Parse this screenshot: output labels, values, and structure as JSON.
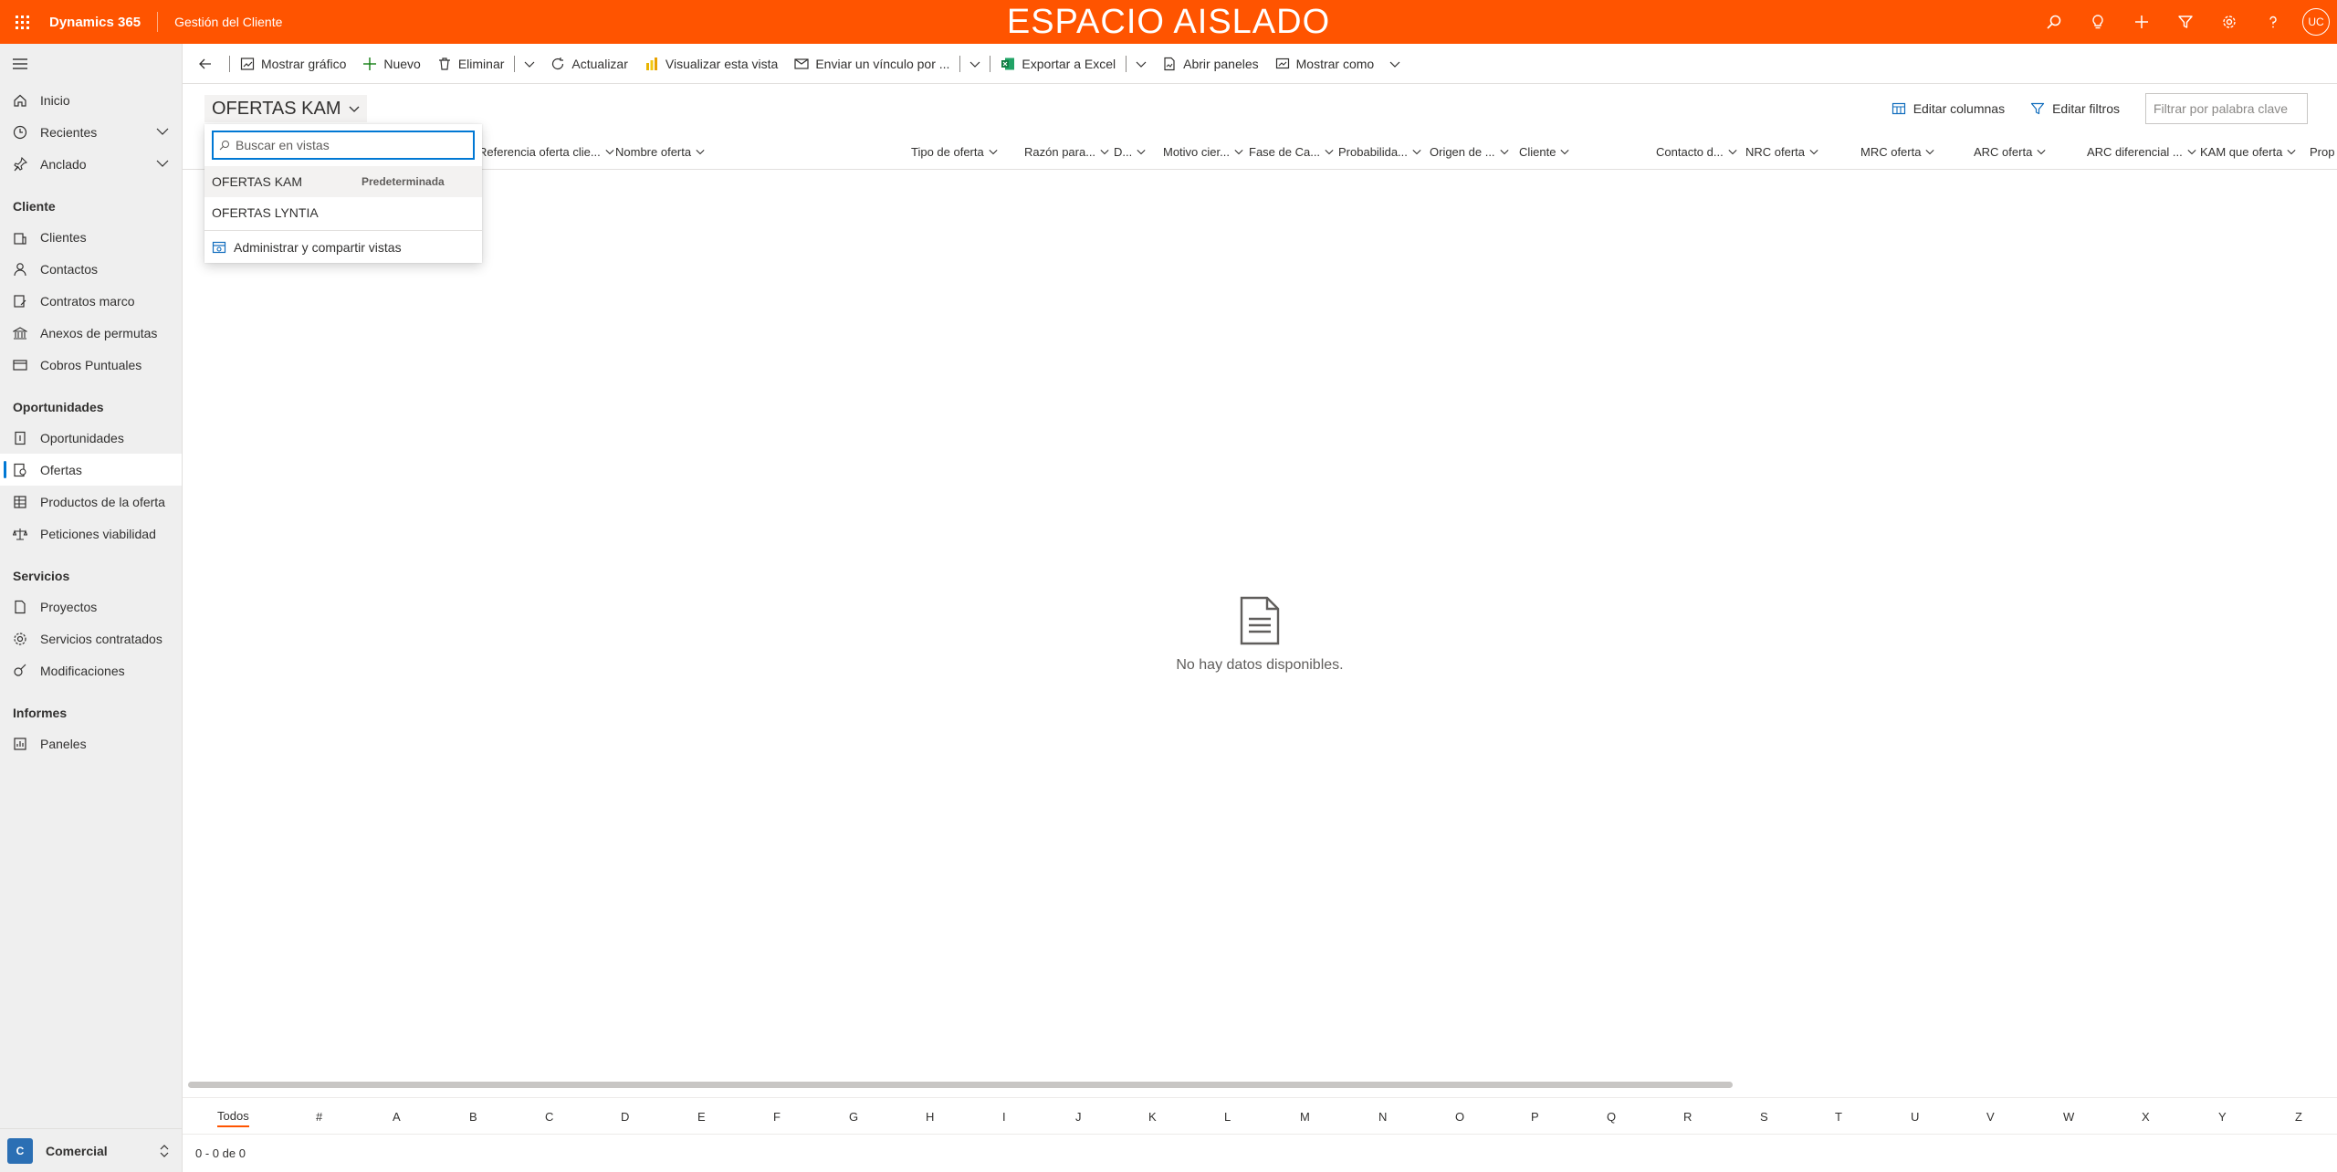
{
  "topbar": {
    "app_name": "Dynamics 365",
    "module_name": "Gestión del Cliente",
    "environment_banner": "ESPACIO AISLADO",
    "user_initials": "UC",
    "bg_color": "#ff5400",
    "icons": [
      "search-icon",
      "lightbulb-icon",
      "plus-icon",
      "filter-icon",
      "gear-icon",
      "help-icon"
    ]
  },
  "sidebar": {
    "top_items": [
      {
        "label": "Inicio",
        "icon": "home-icon"
      },
      {
        "label": "Recientes",
        "icon": "clock-icon"
      },
      {
        "label": "Anclado",
        "icon": "pin-icon"
      }
    ],
    "sections": [
      {
        "title": "Cliente",
        "items": [
          {
            "label": "Clientes",
            "icon": "building-icon"
          },
          {
            "label": "Contactos",
            "icon": "person-icon"
          },
          {
            "label": "Contratos marco",
            "icon": "contract-icon"
          },
          {
            "label": "Anexos de permutas",
            "icon": "bank-icon"
          },
          {
            "label": "Cobros Puntuales",
            "icon": "card-icon"
          }
        ]
      },
      {
        "title": "Oportunidades",
        "items": [
          {
            "label": "Oportunidades",
            "icon": "opportunity-icon"
          },
          {
            "label": "Ofertas",
            "icon": "quote-icon",
            "selected": true
          },
          {
            "label": "Productos de la oferta",
            "icon": "table-icon"
          },
          {
            "label": "Peticiones viabilidad",
            "icon": "scale-icon"
          }
        ]
      },
      {
        "title": "Servicios",
        "items": [
          {
            "label": "Proyectos",
            "icon": "document-icon"
          },
          {
            "label": "Servicios contratados",
            "icon": "services-icon"
          },
          {
            "label": "Modificaciones",
            "icon": "modify-icon"
          }
        ]
      },
      {
        "title": "Informes",
        "items": [
          {
            "label": "Paneles",
            "icon": "dashboard-icon"
          }
        ]
      }
    ],
    "area": {
      "badge": "C",
      "label": "Comercial",
      "badge_color": "#2b6fb4"
    }
  },
  "commandbar": {
    "items": [
      {
        "label": "Mostrar gráfico",
        "icon": "chart-icon"
      },
      {
        "label": "Nuevo",
        "icon": "plus-icon"
      },
      {
        "label": "Eliminar",
        "icon": "trash-icon"
      },
      {
        "label": "Actualizar",
        "icon": "refresh-icon"
      },
      {
        "label": "Visualizar esta vista",
        "icon": "powerbi-icon"
      },
      {
        "label": "Enviar un vínculo por ...",
        "icon": "mail-link-icon"
      },
      {
        "label": "Exportar a Excel",
        "icon": "excel-icon"
      },
      {
        "label": "Abrir paneles",
        "icon": "panel-icon"
      },
      {
        "label": "Mostrar como",
        "icon": "view-icon"
      }
    ]
  },
  "view": {
    "title": "OFERTAS KAM",
    "edit_columns": "Editar columnas",
    "edit_filters": "Editar filtros",
    "keyword_placeholder": "Filtrar por palabra clave"
  },
  "columns": [
    "Referencia oferta clie...",
    "Nombre oferta",
    "Tipo de oferta",
    "Razón para...",
    "D...",
    "Motivo cier...",
    "Fase de Ca...",
    "Probabilida...",
    "Origen de ...",
    "Cliente",
    "Contacto d...",
    "NRC oferta",
    "MRC oferta",
    "ARC oferta",
    "ARC diferencial ...",
    "KAM que oferta",
    "Prop"
  ],
  "empty_state": "No hay datos disponibles.",
  "jumpbar": [
    "Todos",
    "#",
    "A",
    "B",
    "C",
    "D",
    "E",
    "F",
    "G",
    "H",
    "I",
    "J",
    "K",
    "L",
    "M",
    "N",
    "O",
    "P",
    "Q",
    "R",
    "S",
    "T",
    "U",
    "V",
    "W",
    "X",
    "Y",
    "Z"
  ],
  "footer_count": "0 - 0 de 0",
  "view_selector": {
    "search_placeholder": "Buscar en vistas",
    "views": [
      {
        "name": "OFERTAS KAM",
        "tag": "Predeterminada"
      },
      {
        "name": "OFERTAS LYNTIA",
        "tag": ""
      }
    ],
    "manage_label": "Administrar y compartir vistas"
  }
}
